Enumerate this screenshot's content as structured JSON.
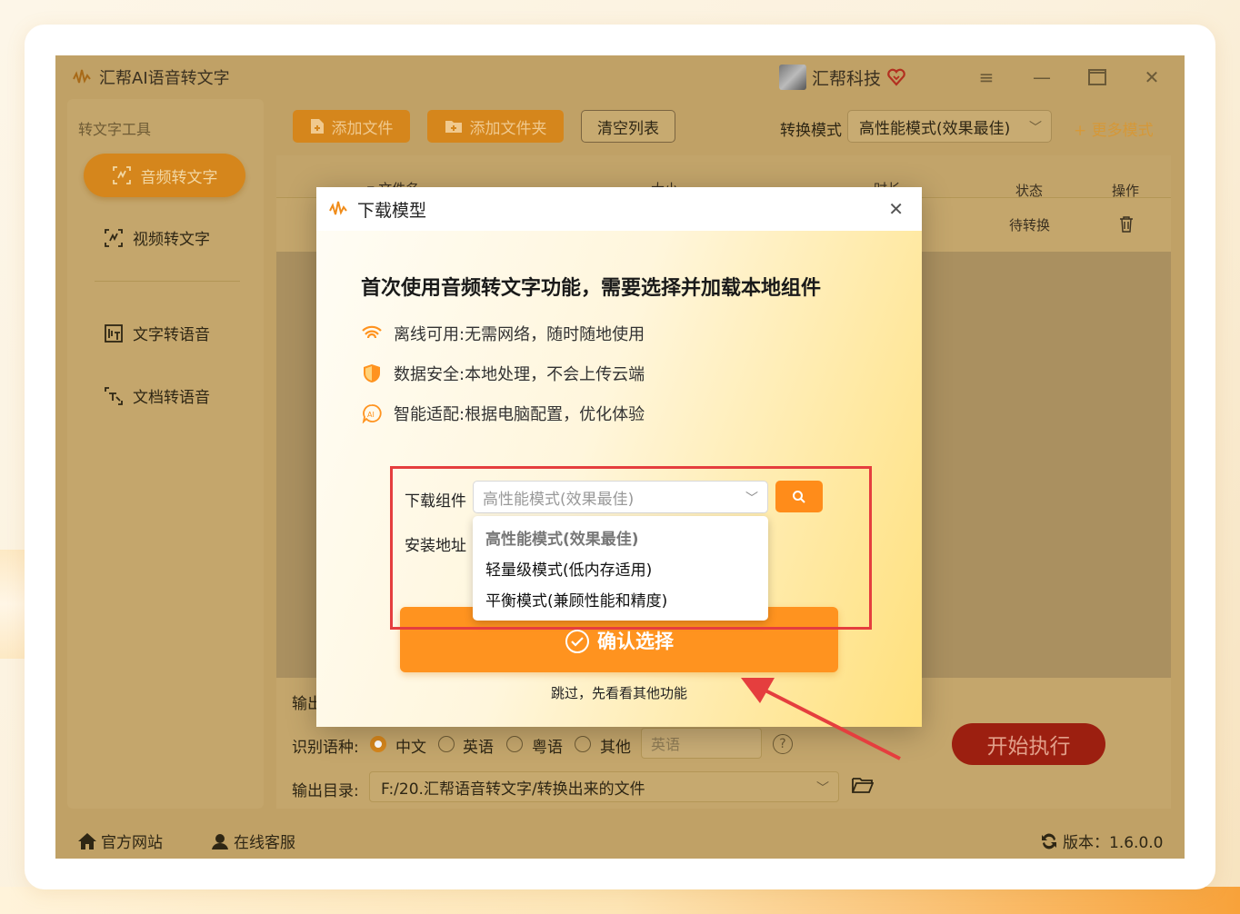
{
  "app": {
    "title": "汇帮AI语音转文字",
    "user_name": "汇帮科技",
    "version": "版本：1.6.0.0"
  },
  "sidebar": {
    "title": "转文字工具",
    "items": [
      {
        "label": "音频转文字",
        "icon": "audio-text-icon",
        "active": true
      },
      {
        "label": "视频转文字",
        "icon": "video-text-icon"
      },
      {
        "label": "文字转语音",
        "icon": "text-speech-icon"
      },
      {
        "label": "文档转语音",
        "icon": "doc-speech-icon"
      }
    ]
  },
  "toolbar": {
    "add_file": "添加文件",
    "add_folder": "添加文件夹",
    "clear_list": "清空列表",
    "mode_label": "转换模式",
    "mode_value": "高性能模式(效果最佳)",
    "more_modes": "+ 更多模式"
  },
  "table": {
    "headers": {
      "filename": "▾ 文件名",
      "size": "大小",
      "duration": "时长",
      "status": "状态",
      "action": "操作"
    },
    "rows": [
      {
        "status": "待转换"
      }
    ]
  },
  "settings": {
    "output_label": "输出",
    "lang_label": "识别语种:",
    "langs": [
      "中文",
      "英语",
      "粤语",
      "其他"
    ],
    "selected_lang": "中文",
    "other_lang_value": "英语",
    "output_dir_label": "输出目录:",
    "output_dir": "F:/20.汇帮语音转文字/转换出来的文件",
    "start_button": "开始执行"
  },
  "footer": {
    "website": "官方网站",
    "support": "在线客服"
  },
  "modal": {
    "title": "下载模型",
    "heading": "首次使用音频转文字功能，需要选择并加载本地组件",
    "features": [
      {
        "text": "离线可用:无需网络，随时随地使用",
        "icon": "wifi-icon"
      },
      {
        "text": "数据安全:本地处理，不会上传云端",
        "icon": "shield-icon"
      },
      {
        "text": "智能适配:根据电脑配置，优化体验",
        "icon": "ai-icon"
      }
    ],
    "download_label": "下载组件",
    "download_placeholder": "高性能模式(效果最佳)",
    "install_label": "安装地址",
    "options": [
      "高性能模式(效果最佳)",
      "轻量级模式(低内存适用)",
      "平衡模式(兼顾性能和精度)"
    ],
    "confirm_button": "确认选择",
    "skip_link": "跳过，先看看其他功能"
  },
  "colors": {
    "accent": "#ff931f",
    "highlight_box": "#e53e3e",
    "start_button": "#9c1f10"
  }
}
